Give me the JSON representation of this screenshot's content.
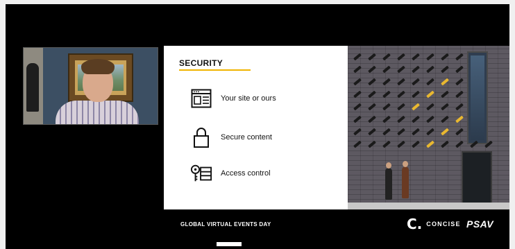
{
  "slide": {
    "title": "SECURITY",
    "accent_color": "#f0b400",
    "features": [
      {
        "icon": "browser-window-icon",
        "label": "Your site or ours"
      },
      {
        "icon": "padlock-icon",
        "label": "Secure content"
      },
      {
        "icon": "key-access-icon",
        "label": "Access control"
      }
    ]
  },
  "footer": {
    "event_label": "GLOBAL VIRTUAL EVENTS DAY",
    "brand_concise_mark": "C.",
    "brand_concise_name": "CONCISE",
    "brand_psav": "PSAV"
  },
  "video": {
    "webcam_icon": "presenter-webcam",
    "photo_icon": "security-cameras-photo"
  }
}
